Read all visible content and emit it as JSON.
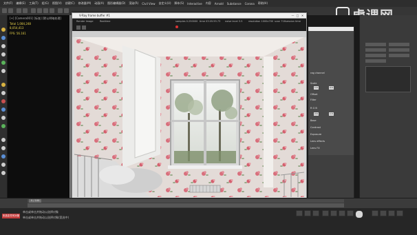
{
  "menu": [
    "文件(F)",
    "编辑(E)",
    "工具(T)",
    "组(G)",
    "视图(V)",
    "创建(C)",
    "修改器(M)",
    "动画(A)",
    "图形编辑器(D)",
    "渲染(R)",
    "Civil View",
    "自定义(U)",
    "脚本(S)",
    "Interactive",
    "内容",
    "Arnold",
    "Substance",
    "Corona",
    "帮助(H)"
  ],
  "workspace_label": "工作区: 默认",
  "watermark": "虎课网",
  "explorer": {
    "title": "名称(按升序排序)",
    "header": "[+] [Camera001] [标准] [默认明暗处理]",
    "stats": [
      "Total  1,084,248",
      "        8,054,413",
      "FPS:   56.161"
    ]
  },
  "vfb": {
    "title": "V-Ray frame buffer #1",
    "controls": [
      "—",
      "□",
      "✕"
    ],
    "toolbar_labels": [
      "Render Image",
      "Realtime",
      "samples 0.250000",
      "time 03:05:59.73",
      "noise level 3.5",
      "resolution 1000x700",
      "scan 716",
      "session time"
    ]
  },
  "popup": {
    "title": "rag channel",
    "rows": [
      "Scale",
      "Offset",
      "Filter",
      "R G B",
      "Base",
      "Contrast",
      "Exposure",
      "Lens effects",
      "Lens FX"
    ],
    "values": [
      "1.0",
      "0.0",
      "2.6",
      "1.0"
    ]
  },
  "status": {
    "badge": "未选定任何对象",
    "messages": [
      "单击或单击并拖动以选择对象",
      "单击或单击并拖动以选择对象(宽选中)"
    ]
  },
  "timeline": {
    "frame_label": "0 / 100"
  },
  "colors": {
    "wallpaper": "#e4dcd8",
    "rose": "#d9727e",
    "accent": "#c23b3b",
    "explorer_text": "#e8d34a"
  }
}
